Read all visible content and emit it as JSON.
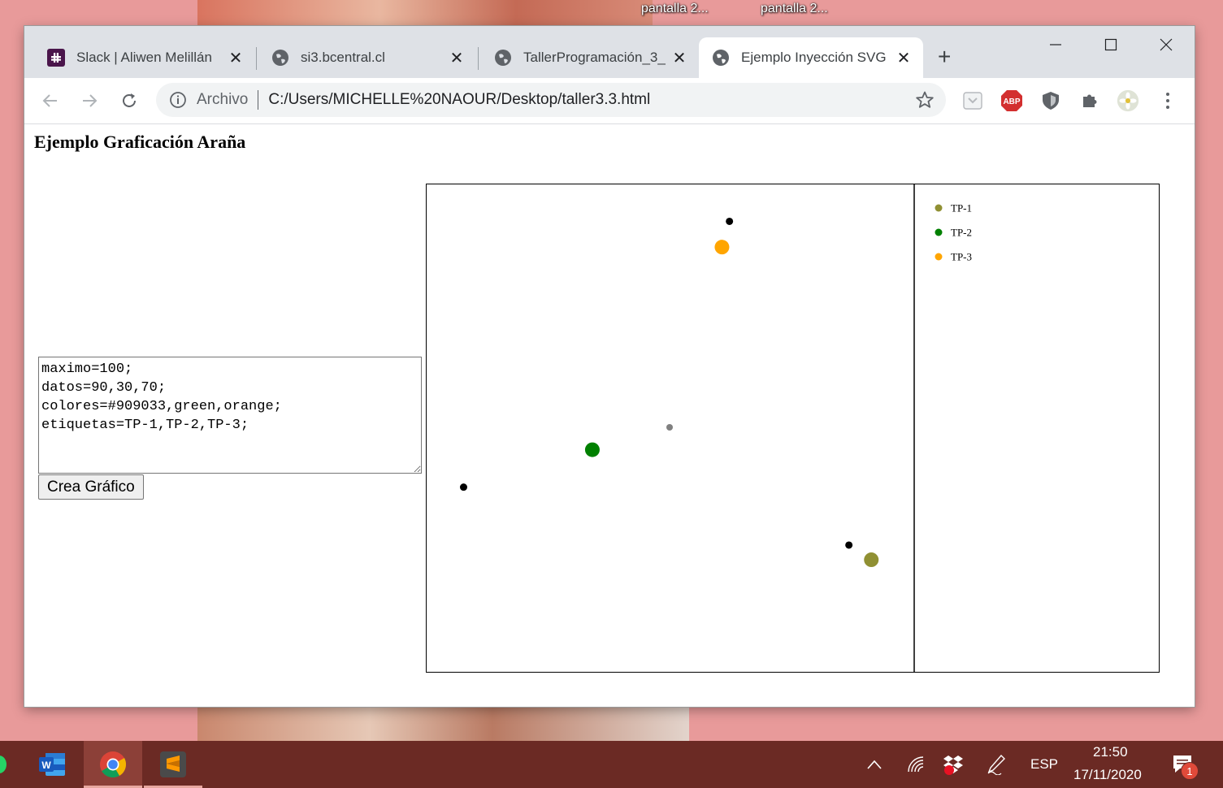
{
  "desktop": {
    "icon_labels": [
      "pantalla 2...",
      "pantalla 2..."
    ]
  },
  "browser": {
    "tabs": [
      {
        "title": "Slack | Aliwen Melillán",
        "icon": "slack-icon"
      },
      {
        "title": "si3.bcentral.cl",
        "icon": "globe-icon"
      },
      {
        "title": "TallerProgramación_3_",
        "icon": "globe-icon"
      },
      {
        "title": "Ejemplo Inyección SVG",
        "icon": "globe-icon",
        "active": true
      }
    ],
    "address": {
      "security_label": "Archivo",
      "url": "C:/Users/MICHELLE%20NAOUR/Desktop/taller3.3.html"
    },
    "extensions": [
      "pocket-icon",
      "adblock-icon",
      "shield-icon",
      "puzzle-icon",
      "profile-avatar"
    ]
  },
  "page": {
    "title": "Ejemplo Graficación Araña",
    "config_text": "maximo=100;\ndatos=90,30,70;\ncolores=#909033,green,orange;\netiquetas=TP-1,TP-2,TP-3;",
    "button_label": "Crea Gráfico"
  },
  "chart_data": {
    "type": "radar",
    "maximum": 100,
    "categories": [
      "TP-1",
      "TP-2",
      "TP-3"
    ],
    "values": [
      90,
      30,
      70
    ],
    "colors": [
      "#909033",
      "green",
      "orange"
    ],
    "legend": [
      {
        "label": "TP-1",
        "color": "#909033"
      },
      {
        "label": "TP-2",
        "color": "green"
      },
      {
        "label": "TP-3",
        "color": "orange"
      }
    ]
  },
  "taskbar": {
    "apps": [
      "word-icon",
      "chrome-icon",
      "sublime-icon"
    ],
    "language": "ESP",
    "time": "21:50",
    "date": "17/11/2020",
    "notification_count": "1"
  }
}
